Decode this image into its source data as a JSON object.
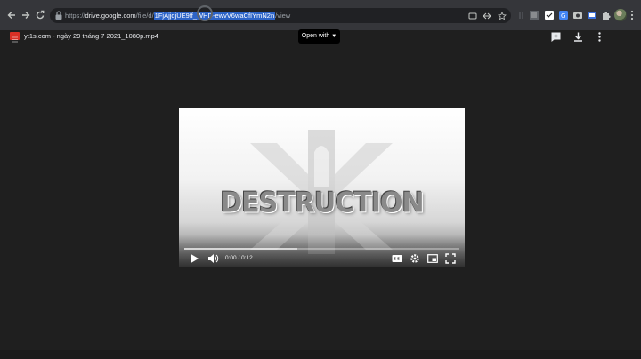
{
  "browser": {
    "url_prefix": "https://",
    "url_host": "drive.google.com",
    "url_path_before": "/file/d/",
    "url_selected": "1FjAjjqjUE9ff_WHD-ewvV6waCfIYmN2n",
    "url_after": "/view"
  },
  "viewer": {
    "file_name": "yt1s.com - ngày 29 tháng 7 2021_1080p.mp4",
    "open_with_label": "Open with"
  },
  "player": {
    "video_title_text": "DESTRUCTION",
    "time_current": "0:00",
    "time_separator": " / ",
    "time_total": "0:12",
    "progress_fraction": 0.0,
    "buffered_fraction": 0.41
  },
  "icons": {
    "back": "back-arrow-icon",
    "forward": "forward-arrow-icon",
    "reload": "reload-icon",
    "lock": "lock-icon",
    "cast": "cast-icon",
    "share": "share-icon",
    "bookmark": "star-icon",
    "add_comment": "add-comment-icon",
    "download": "download-icon",
    "more": "more-vert-icon",
    "play": "play-icon",
    "volume": "volume-icon",
    "captions": "captions-icon",
    "settings": "gear-icon",
    "miniplayer": "miniplayer-icon",
    "fullscreen": "fullscreen-icon"
  },
  "colors": {
    "chrome_bg": "#35363a",
    "page_bg": "#1f1f1f",
    "selection": "#2d64c8",
    "file_icon": "#d93025"
  }
}
